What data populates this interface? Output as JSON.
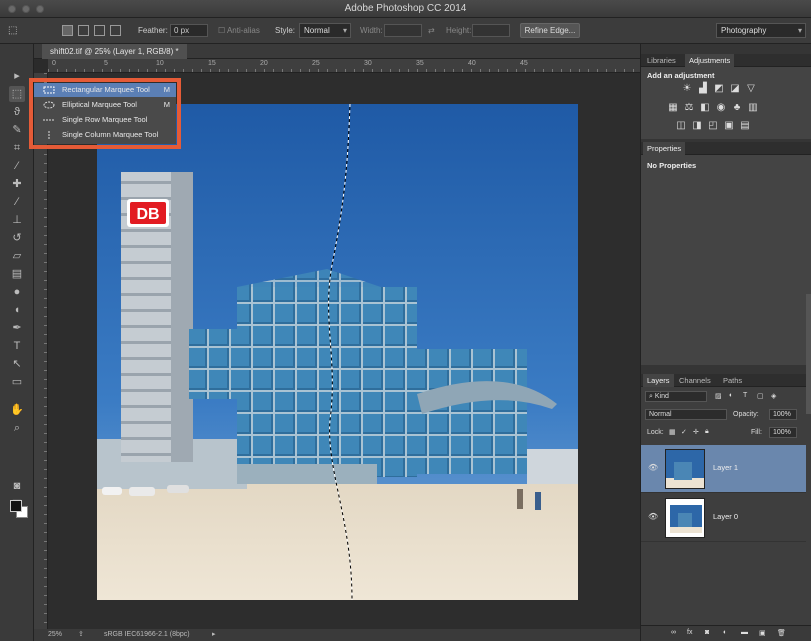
{
  "window": {
    "title": "Adobe Photoshop CC 2014"
  },
  "options_bar": {
    "feather_label": "Feather:",
    "feather_value": "0 px",
    "anti_alias_label": "Anti-alias",
    "style_label": "Style:",
    "style_value": "Normal",
    "width_label": "Width:",
    "height_label": "Height:",
    "refine_edge_label": "Refine Edge...",
    "workspace_value": "Photography"
  },
  "document": {
    "tab_label": "shift02.tif @ 25% (Layer 1, RGB/8) *",
    "zoom": "25%",
    "profile": "sRGB IEC61966-2.1 (8bpc)",
    "ruler_labels": [
      "0",
      "5",
      "10",
      "15",
      "20",
      "25",
      "30",
      "35",
      "40",
      "45"
    ]
  },
  "tool_flyout": {
    "items": [
      {
        "label": "Rectangular Marquee Tool",
        "shortcut": "M"
      },
      {
        "label": "Elliptical Marquee Tool",
        "shortcut": "M"
      },
      {
        "label": "Single Row Marquee Tool"
      },
      {
        "label": "Single Column Marquee Tool"
      }
    ],
    "highlight_color": "#e55b37"
  },
  "photo": {
    "sign_text": "DB"
  },
  "panels": {
    "adjustments": {
      "tabs": [
        "Libraries",
        "Adjustments"
      ],
      "heading": "Add an adjustment"
    },
    "properties": {
      "tab": "Properties",
      "empty_text": "No Properties"
    },
    "layers": {
      "tabs": [
        "Layers",
        "Channels",
        "Paths"
      ],
      "filter_value": "Kind",
      "blend_mode": "Normal",
      "opacity_label": "Opacity:",
      "opacity_value": "100%",
      "lock_label": "Lock:",
      "fill_label": "Fill:",
      "fill_value": "100%",
      "items": [
        {
          "name": "Layer 1",
          "selected": true
        },
        {
          "name": "Layer 0",
          "selected": false
        }
      ]
    }
  },
  "colors": {
    "selection": "#5b7fb5",
    "layer_selected": "#6a87ad"
  }
}
